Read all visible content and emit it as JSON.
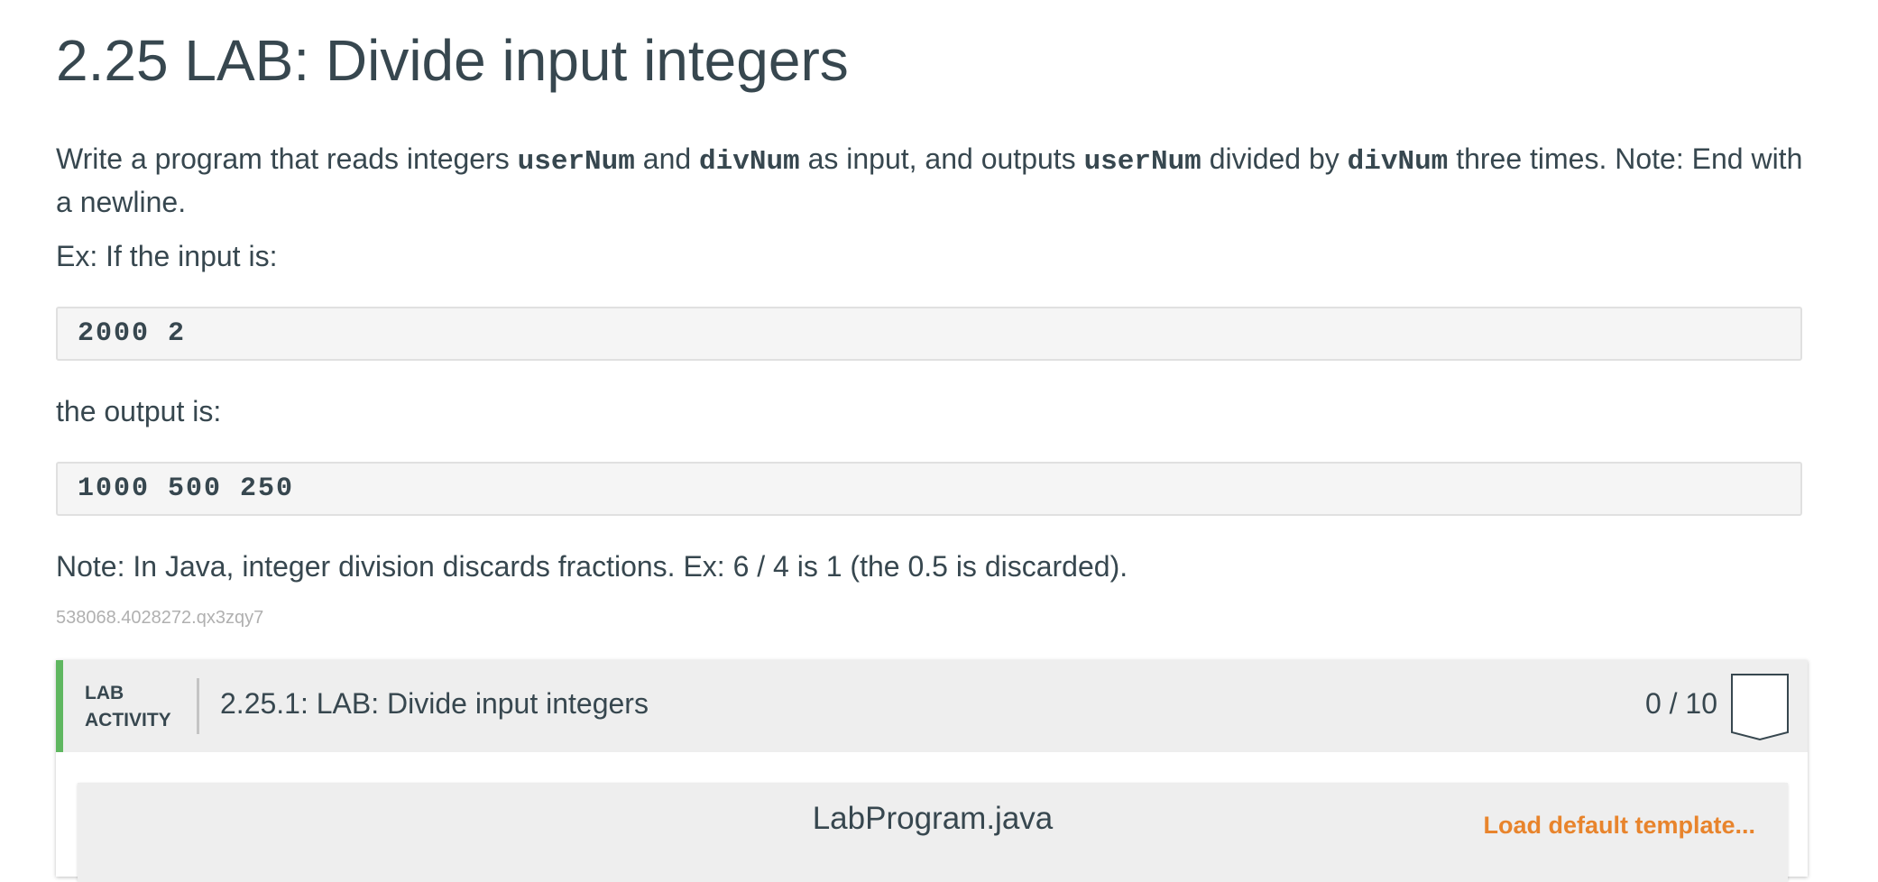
{
  "page": {
    "title": "2.25 LAB: Divide input integers"
  },
  "description": {
    "text1": "Write a program that reads integers ",
    "var1": "userNum",
    "text2": " and ",
    "var2": "divNum",
    "text3": " as input, and outputs ",
    "var3": "userNum",
    "text4": " divided by ",
    "var4": "divNum",
    "text5": " three times. Note: End with a newline.",
    "example_input_label": "Ex: If the input is:",
    "example_input": "2000 2",
    "example_output_label": "the output is:",
    "example_output": "1000 500 250",
    "note": "Note: In Java, integer division discards fractions. Ex: 6 / 4 is 1 (the 0.5 is discarded).",
    "reference_id": "538068.4028272.qx3zqy7"
  },
  "lab_activity": {
    "tag_line1": "LAB",
    "tag_line2": "ACTIVITY",
    "title": "2.25.1: LAB: Divide input integers",
    "score": "0 / 10",
    "accent_color": "#5fb760"
  },
  "editor": {
    "file_name": "LabProgram.java",
    "load_template_label": "Load default template...",
    "link_color": "#e8842c"
  }
}
